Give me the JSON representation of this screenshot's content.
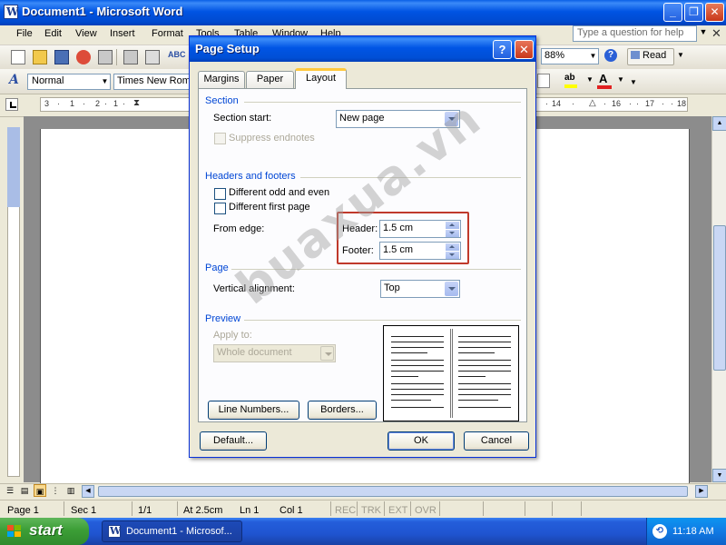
{
  "window": {
    "title": "Document1 - Microsoft Word",
    "min": "_",
    "max": "❐",
    "close": "✕"
  },
  "menu": {
    "items": [
      "File",
      "Edit",
      "View",
      "Insert",
      "Format",
      "Tools",
      "Table",
      "Window",
      "Help"
    ],
    "help_placeholder": "Type a question for help",
    "doc_close": "✕"
  },
  "toolbar": {
    "zoom": "88%",
    "read_label": "Read",
    "style_value": "Normal",
    "font_value": "Times New Roman",
    "spell_label": "ABC"
  },
  "ruler": {
    "left_labels": [
      "3",
      "·",
      "1",
      "·",
      "2",
      "·",
      "1",
      "·"
    ],
    "right_labels": [
      "·",
      "14",
      "·",
      "·",
      "16",
      "·",
      "·",
      "17",
      "·",
      "·",
      "18"
    ]
  },
  "dialog": {
    "title": "Page Setup",
    "help": "?",
    "close": "✕",
    "tabs": [
      "Margins",
      "Paper",
      "Layout"
    ],
    "active_tab": "Layout",
    "section": {
      "title": "Section",
      "start_label": "Section start:",
      "start_value": "New page",
      "suppress_label": "Suppress endnotes"
    },
    "headers_footers": {
      "title": "Headers and footers",
      "odd_even_label": "Different odd and even",
      "first_page_label": "Different first page",
      "from_edge_label": "From edge:",
      "header_label": "Header:",
      "header_value": "1.5 cm",
      "footer_label": "Footer:",
      "footer_value": "1.5 cm"
    },
    "page": {
      "title": "Page",
      "valign_label": "Vertical alignment:",
      "valign_value": "Top"
    },
    "preview": {
      "title": "Preview",
      "apply_label": "Apply to:",
      "apply_value": "Whole document"
    },
    "buttons": {
      "line_numbers": "Line Numbers...",
      "borders": "Borders...",
      "default": "Default...",
      "ok": "OK",
      "cancel": "Cancel"
    }
  },
  "watermark": "buaxua.vn",
  "status": {
    "page": "Page  1",
    "sec": "Sec  1",
    "pages": "1/1",
    "at": "At  2.5cm",
    "ln": "Ln  1",
    "col": "Col  1",
    "rec": "REC",
    "trk": "TRK",
    "ext": "EXT",
    "ovr": "OVR"
  },
  "taskbar": {
    "start": "start",
    "task_word": "Document1 - Microsof...",
    "clock": "11:18 AM"
  },
  "colors": {
    "accent_blue": "#0046d5",
    "highlight_red": "#c0392b",
    "xp_green": "#3c9e36"
  }
}
